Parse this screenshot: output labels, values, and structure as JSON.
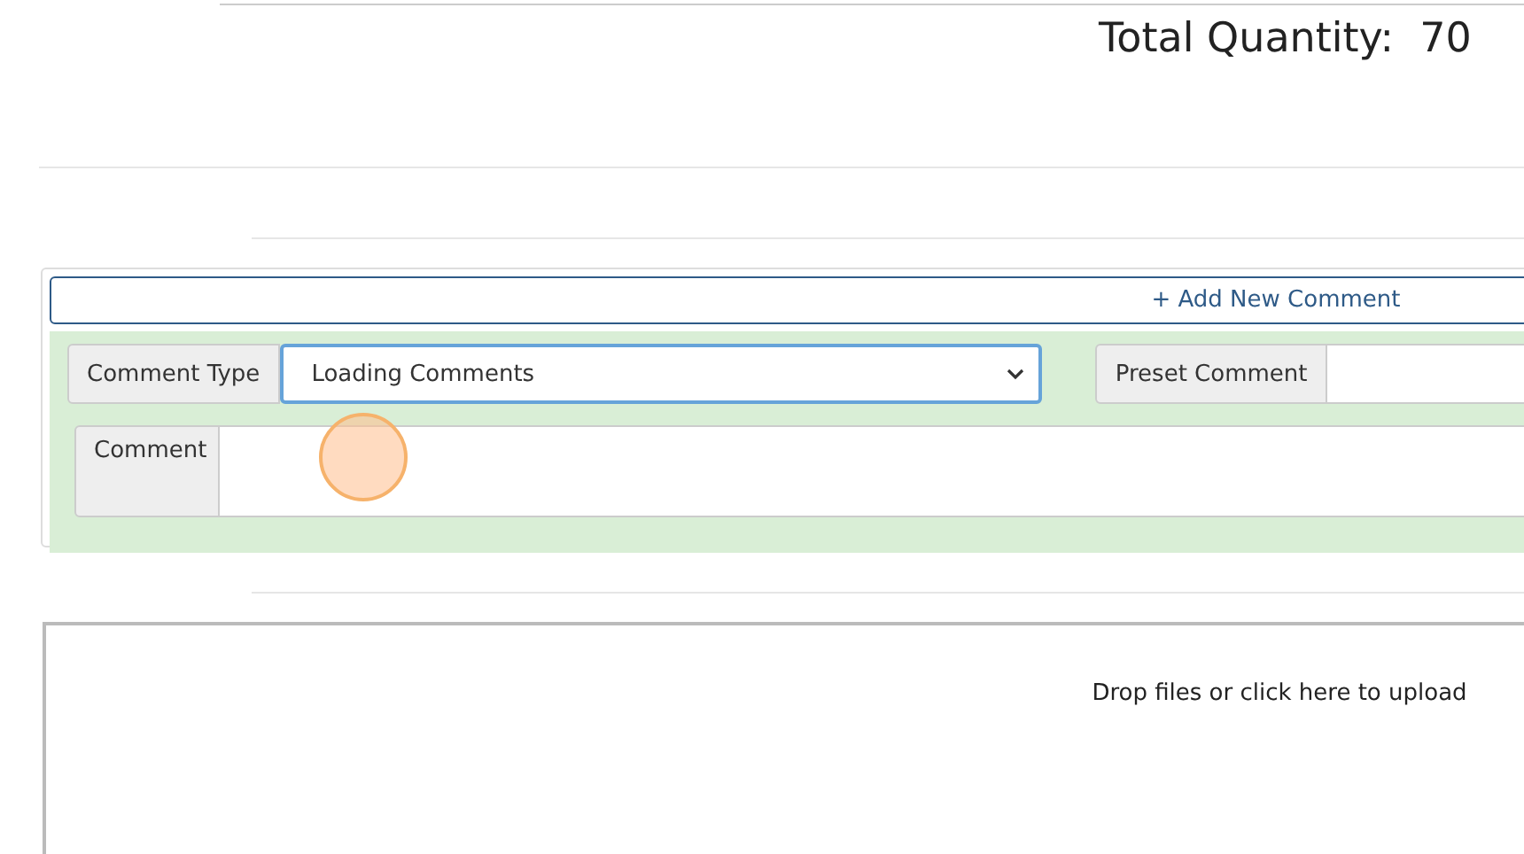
{
  "summary": {
    "total_quantity": "Total Quantity:  70"
  },
  "comments": {
    "add_button": "+ Add New Comment",
    "comment_type": {
      "label": "Comment Type",
      "value": "Loading Comments"
    },
    "preset_comment": {
      "label": "Preset Comment"
    },
    "comment": {
      "label": "Comment"
    }
  },
  "upload": {
    "prompt": "Drop files or click here to upload"
  }
}
